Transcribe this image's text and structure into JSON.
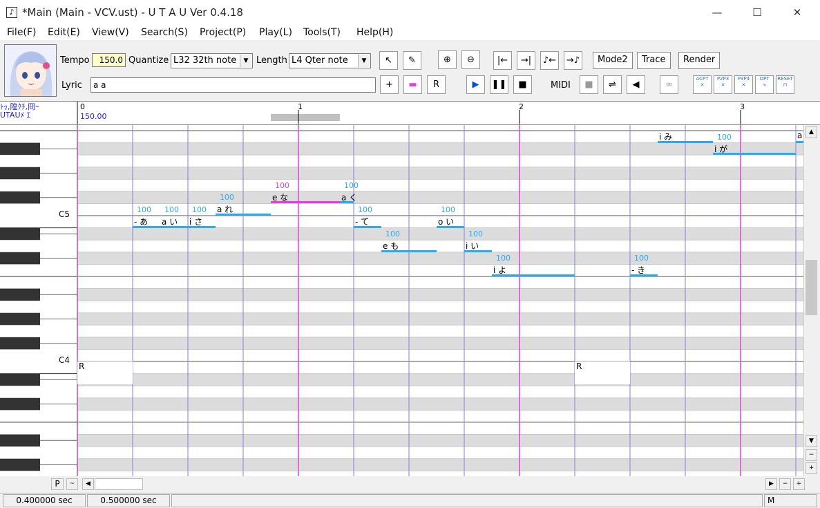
{
  "window": {
    "title": "*Main (Main - VCV.ust) - U T A U Ver 0.4.18",
    "minimize": "—",
    "maximize": "☐",
    "close": "✕"
  },
  "menu": [
    "File(F)",
    "Edit(E)",
    "View(V)",
    "Search(S)",
    "Project(P)",
    "Play(L)",
    "Tools(T)",
    "Help(H)"
  ],
  "toolbar": {
    "tempo_label": "Tempo",
    "tempo_value": "150.0",
    "quantize_label": "Quantize",
    "quantize_value": "L32 32th note",
    "length_label": "Length",
    "length_value": "L4  Qter note",
    "lyric_label": "Lyric",
    "lyric_value": "a a",
    "midi_label": "MIDI",
    "mode2": "Mode2",
    "trace": "Trace",
    "render": "Render",
    "plugin_labels": [
      "ACPT",
      "P2P3",
      "P3P4",
      "OPT",
      "RESET"
    ]
  },
  "ruler": {
    "track_name_line1": "ﾄｯ,隍ｸﾁ,冏ｰ",
    "track_name_line2": "UTAUﾒ ｴ",
    "start_tempo": "150.00",
    "measures": [
      "0",
      "1",
      "2",
      "3"
    ]
  },
  "keys": {
    "c5": "C5",
    "c4": "C4"
  },
  "notes": [
    {
      "lyric": "i み",
      "vel": "",
      "color": "#2aaaf5"
    },
    {
      "lyric": "i が",
      "vel": "100",
      "color": "#2aaaf5"
    },
    {
      "lyric": "a",
      "vel": "",
      "color": "#2aaaf5"
    },
    {
      "lyric": "e な",
      "vel": "100",
      "color": "#e040e0"
    },
    {
      "lyric": "a く",
      "vel": "100",
      "color": "#2aaaf5"
    },
    {
      "lyric": "a れ",
      "vel": "100",
      "color": "#2aaaf5"
    },
    {
      "lyric": "- あ",
      "vel": "100",
      "color": "#2aaaf5"
    },
    {
      "lyric": "a い",
      "vel": "100",
      "color": "#2aaaf5"
    },
    {
      "lyric": "i さ",
      "vel": "100",
      "color": "#2aaaf5"
    },
    {
      "lyric": "- て",
      "vel": "100",
      "color": "#2aaaf5"
    },
    {
      "lyric": "o い",
      "vel": "100",
      "color": "#2aaaf5"
    },
    {
      "lyric": "e も",
      "vel": "100",
      "color": "#2aaaf5"
    },
    {
      "lyric": "i い",
      "vel": "100",
      "color": "#2aaaf5"
    },
    {
      "lyric": "i よ",
      "vel": "100",
      "color": "#2aaaf5"
    },
    {
      "lyric": "- き",
      "vel": "100",
      "color": "#2aaaf5"
    },
    {
      "lyric": "R",
      "vel": "",
      "color": "#444"
    },
    {
      "lyric": "R",
      "vel": "",
      "color": "#444"
    }
  ],
  "scroll": {
    "p_label": "P",
    "tilde": "~",
    "minus": "−",
    "plus": "+"
  },
  "status": {
    "time1": "0.400000 sec",
    "time2": "0.500000 sec",
    "mode": "M"
  }
}
